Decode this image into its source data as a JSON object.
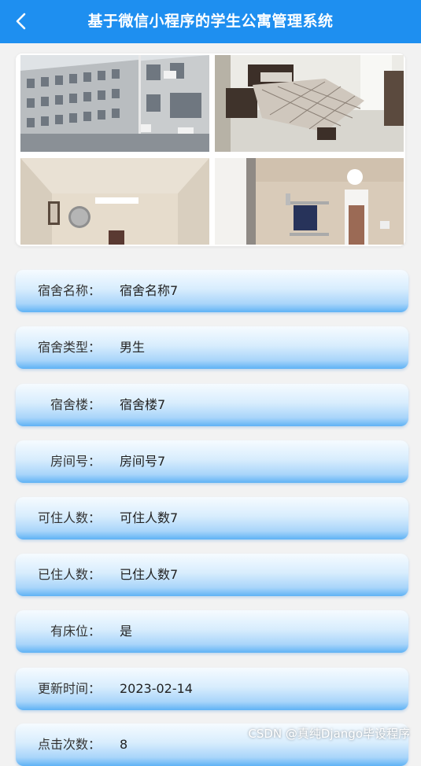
{
  "header": {
    "title": "基于微信小程序的学生公寓管理系统",
    "back_icon": "chevron-left-icon"
  },
  "fields": [
    {
      "label": "宿舍名称：",
      "value": "宿舍名称7"
    },
    {
      "label": "宿舍类型：",
      "value": "男生"
    },
    {
      "label": "宿舍楼：",
      "value": "宿舍楼7"
    },
    {
      "label": "房间号：",
      "value": "房间号7"
    },
    {
      "label": "可住人数：",
      "value": "可住人数7"
    },
    {
      "label": "已住人数：",
      "value": "已住人数7"
    },
    {
      "label": "有床位：",
      "value": "是"
    },
    {
      "label": "更新时间：",
      "value": "2023-02-14"
    },
    {
      "label": "点击次数：",
      "value": "8"
    }
  ],
  "watermark": "CSDN @真纯Django毕设程序",
  "colors": {
    "header_bg": "#1e8ff0",
    "row_gradient_bottom": "#5fb2f5"
  }
}
